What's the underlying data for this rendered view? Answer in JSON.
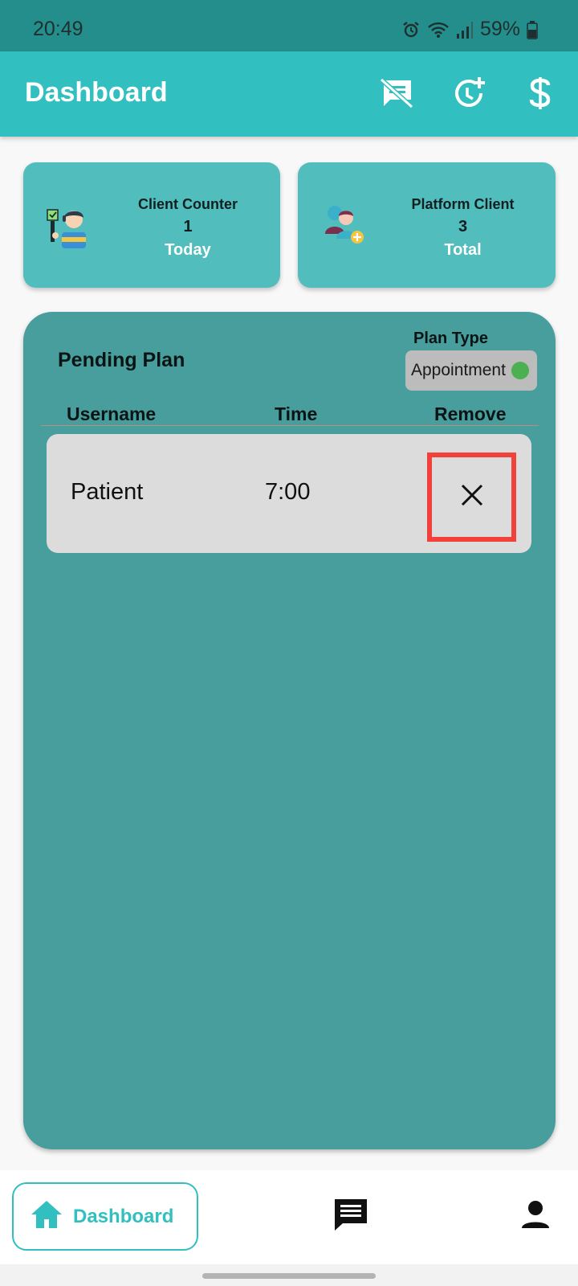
{
  "status_bar": {
    "time": "20:49",
    "battery": "59%",
    "icons": [
      "alarm-icon",
      "wifi-icon",
      "signal-icon",
      "battery-icon"
    ]
  },
  "app_bar": {
    "title": "Dashboard",
    "actions": [
      "speaker-notes-off-icon",
      "add-alarm-icon",
      "dollar-icon"
    ]
  },
  "stats": [
    {
      "title": "Client Counter",
      "value": "1",
      "sub": "Today",
      "icon": "client-avatar-icon"
    },
    {
      "title": "Platform Client",
      "value": "3",
      "sub": "Total",
      "icon": "add-users-icon"
    }
  ],
  "pending": {
    "title": "Pending Plan",
    "plan_type_label": "Plan Type",
    "plan_type_value": "Appointment",
    "plan_type_color": "#4caf50",
    "columns": [
      "Username",
      "Time",
      "Remove"
    ],
    "rows": [
      {
        "username": "Patient",
        "time": "7:00"
      }
    ]
  },
  "bottom_nav": {
    "home_label": "Dashboard",
    "items": [
      "home-icon",
      "chat-icon",
      "person-icon"
    ]
  },
  "colors": {
    "accent": "#31bfbf",
    "status_bar": "#238e8c",
    "panel": "#479e9d",
    "card": "#52bdbd",
    "highlight": "#f1413a"
  }
}
